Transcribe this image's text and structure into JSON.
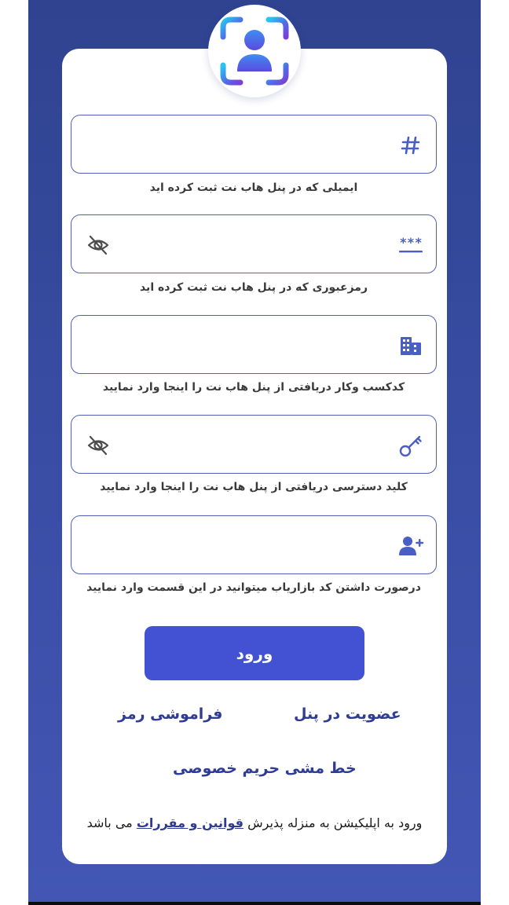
{
  "colors": {
    "background_top": "#2f4390",
    "background_bottom": "#4356b4",
    "card": "#ffffff",
    "field_border": "#5060b8",
    "icon_accent": "#4a5fc4",
    "button": "#4252d2",
    "link": "#2f3c96"
  },
  "header": {
    "icon": "face-scan-user-icon"
  },
  "fields": [
    {
      "icon": "hash-icon",
      "value": "",
      "hint": "ایمیلی که در پنل هاب نت ثبت کرده اید",
      "visibility_toggle": false
    },
    {
      "icon": "password-asterisks-icon",
      "value": "",
      "hint": "رمزعبوری که در پنل هاب نت ثبت کرده اید",
      "visibility_toggle": true,
      "toggle_icon": "eye-off-icon"
    },
    {
      "icon": "building-icon",
      "value": "",
      "hint": "کدکسب وکار دریافتی از پنل هاب نت را اینجا وارد نمایید",
      "visibility_toggle": false
    },
    {
      "icon": "key-icon",
      "value": "",
      "hint": "کلید دسترسی دریافتی از پنل هاب نت را اینجا وارد نمایید",
      "visibility_toggle": true,
      "toggle_icon": "eye-off-icon"
    },
    {
      "icon": "user-plus-icon",
      "value": "",
      "hint": "درصورت داشتن کد بازاریاب میتوانید در این قسمت وارد نمایید",
      "visibility_toggle": false
    }
  ],
  "login_button": {
    "label": "ورود"
  },
  "links": {
    "register": "عضویت در پنل",
    "forgot_password": "فراموشی رمز",
    "privacy_policy": "خط مشی حریم خصوصی"
  },
  "terms": {
    "prefix": "ورود به اپلیکیشن به منزله پذیرش",
    "link": "قوانین و مقررات",
    "suffix": "می باشد"
  }
}
